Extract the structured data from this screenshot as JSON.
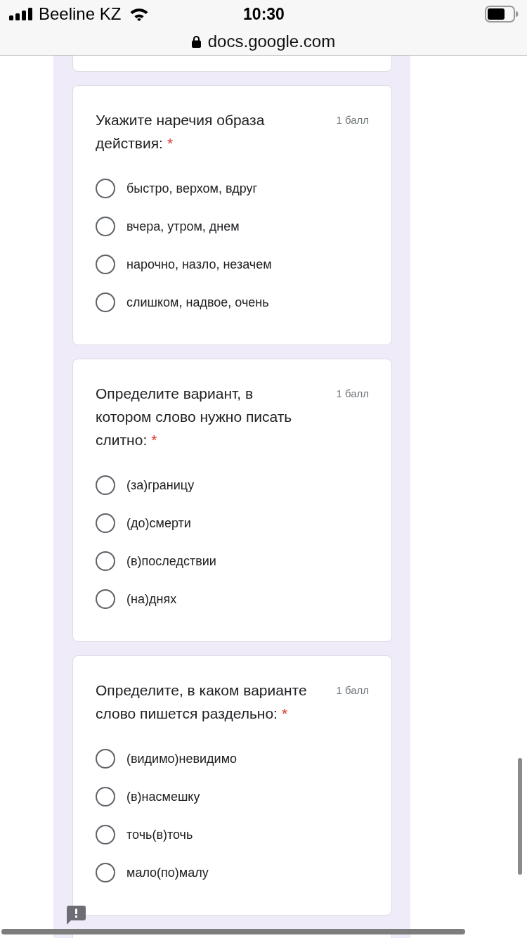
{
  "status_bar": {
    "carrier": "Beeline KZ",
    "time": "10:30"
  },
  "address_bar": {
    "url": "docs.google.com"
  },
  "questions": [
    {
      "title": "Укажите наречия образа действия:",
      "required_mark": "*",
      "points": "1 балл",
      "options": [
        {
          "label": "быстро, верхом, вдруг",
          "selected": false
        },
        {
          "label": "вчера, утром, днем",
          "selected": false
        },
        {
          "label": "нарочно, назло, незачем",
          "selected": false
        },
        {
          "label": "слишком, надвое, очень",
          "selected": false
        }
      ]
    },
    {
      "title": "Определите вариант, в котором слово нужно писать слитно:",
      "required_mark": "*",
      "points": "1 балл",
      "options": [
        {
          "label": "(за)границу",
          "selected": false
        },
        {
          "label": "(до)смерти",
          "selected": false
        },
        {
          "label": "(в)последствии",
          "selected": false
        },
        {
          "label": "(на)днях",
          "selected": false
        }
      ]
    },
    {
      "title": "Определите, в каком варианте слово пишется раздельно:",
      "required_mark": "*",
      "points": "1 балл",
      "options": [
        {
          "label": "(видимо)невидимо",
          "selected": false
        },
        {
          "label": "(в)насмешку",
          "selected": false
        },
        {
          "label": "точь(в)точь",
          "selected": false
        },
        {
          "label": "мало(по)малу",
          "selected": false
        }
      ]
    }
  ]
}
